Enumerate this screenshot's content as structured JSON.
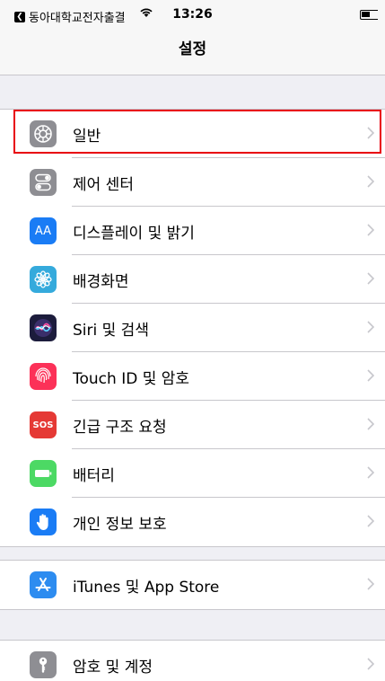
{
  "status_bar": {
    "back_app": "동아대학교전자출결",
    "time": "13:26"
  },
  "nav": {
    "title": "설정"
  },
  "groups": [
    {
      "items": [
        {
          "label": "일반",
          "icon": "gear-icon",
          "color": "#8e8e93"
        },
        {
          "label": "제어 센터",
          "icon": "toggle-icon",
          "color": "#8e8e93"
        },
        {
          "label": "디스플레이 및 밝기",
          "icon": "text-size-icon",
          "icon_text": "AA",
          "color": "#1a7cf5"
        },
        {
          "label": "배경화면",
          "icon": "flower-icon",
          "color": "#35aadc"
        },
        {
          "label": "Siri 및 검색",
          "icon": "siri-icon",
          "color": "#1c1c3c"
        },
        {
          "label": "Touch ID 및 암호",
          "icon": "fingerprint-icon",
          "color": "#fc3158"
        },
        {
          "label": "긴급 구조 요청",
          "icon": "sos-icon",
          "icon_text": "SOS",
          "color": "#e53935"
        },
        {
          "label": "배터리",
          "icon": "battery-icon",
          "color": "#4cd964"
        },
        {
          "label": "개인 정보 보호",
          "icon": "hand-icon",
          "color": "#1a7cf5"
        }
      ]
    },
    {
      "items": [
        {
          "label": "iTunes 및 App Store",
          "icon": "app-store-icon",
          "color": "#2d8cf0"
        }
      ]
    },
    {
      "items": [
        {
          "label": "암호 및 계정",
          "icon": "key-icon",
          "color": "#8e8e93"
        }
      ]
    }
  ],
  "highlight_color": "#e8000d"
}
